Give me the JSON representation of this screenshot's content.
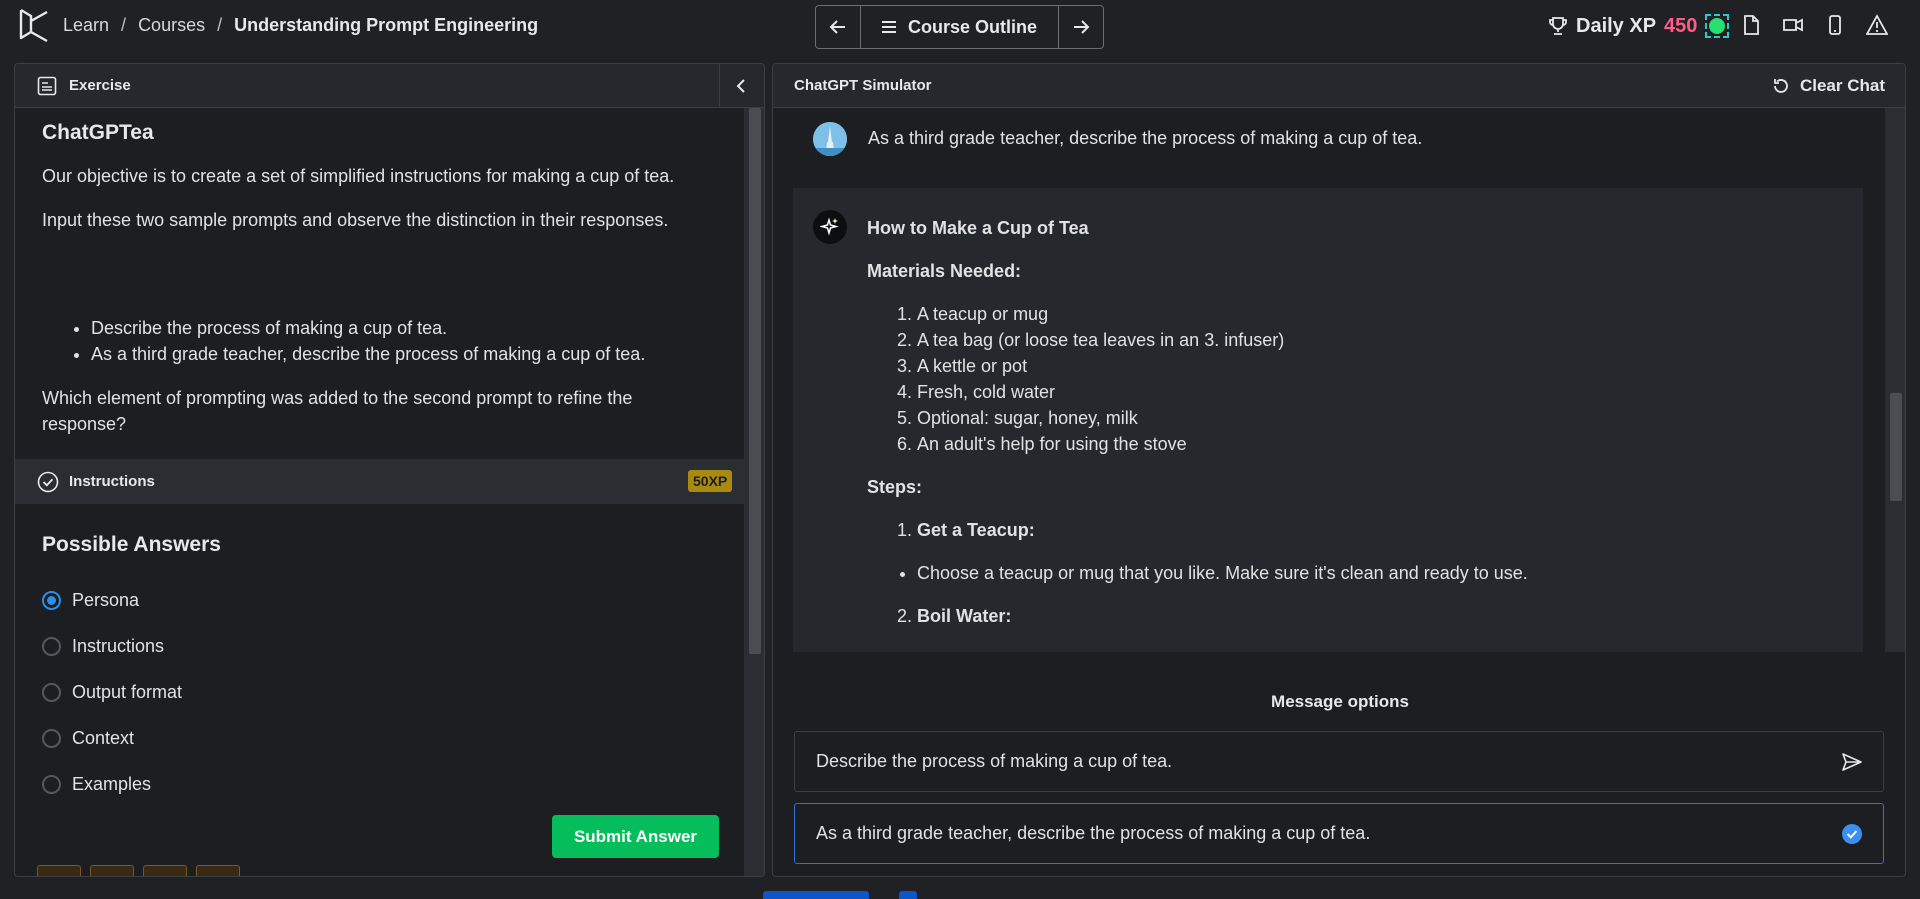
{
  "breadcrumb": {
    "learn": "Learn",
    "courses": "Courses",
    "sep": "/",
    "current": "Understanding Prompt Engineering"
  },
  "outline": {
    "label": "Course Outline"
  },
  "xp": {
    "label": "Daily XP",
    "value": "450"
  },
  "exercise": {
    "header": "Exercise",
    "title": "ChatGPTea",
    "p1": "Our objective is to create a set of simplified instructions for making a cup of tea.",
    "p2": "Input these two sample prompts and observe the distinction in their responses.",
    "bullets": [
      "Describe the process of making a cup of tea.",
      "As a third grade teacher, describe the process of making a cup of tea."
    ],
    "question": "Which element of prompting was added to the second prompt to refine the response?"
  },
  "instructions": {
    "label": "Instructions",
    "xp_badge": "50XP"
  },
  "answers": {
    "title": "Possible Answers",
    "options": [
      "Persona",
      "Instructions",
      "Output format",
      "Context",
      "Examples"
    ],
    "selected": "Persona",
    "submit_label": "Submit Answer"
  },
  "chat": {
    "header": "ChatGPT Simulator",
    "clear_label": "Clear Chat",
    "user_message": "As a third grade teacher, describe the process of making a cup of tea.",
    "reply": {
      "title": "How to Make a Cup of Tea",
      "materials_label": "Materials Needed:",
      "materials": [
        "A teacup or mug",
        "A tea bag (or loose tea leaves in an 3. infuser)",
        "A kettle or pot",
        "Fresh, cold water",
        "Optional: sugar, honey, milk",
        "An adult's help for using the stove"
      ],
      "steps_label": "Steps:",
      "step1_title": "Get a Teacup:",
      "step1_detail": "Choose a teacup or mug that you like. Make sure it's clean and ready to use.",
      "step2_title": "Boil Water:"
    }
  },
  "message_options": {
    "title": "Message options",
    "options": [
      "Describe the process of making a cup of tea.",
      "As a third grade teacher, describe the process of making a cup of tea."
    ],
    "selected_index": 1
  },
  "colors": {
    "accent_blue": "#2f8ee6",
    "submit_green": "#06bd5b",
    "xp_pink": "#ff5c8a",
    "badge_gold": "#a88a10"
  },
  "icons": [
    "datacamp-logo-icon",
    "arrow-left-icon",
    "menu-icon",
    "arrow-right-icon",
    "trophy-icon",
    "document-icon",
    "video-icon",
    "mobile-icon",
    "warning-icon",
    "exercise-icon",
    "chevron-left-icon",
    "check-circle-icon",
    "reset-icon",
    "user-avatar-icon",
    "sparkle-icon",
    "send-icon",
    "check-icon"
  ]
}
